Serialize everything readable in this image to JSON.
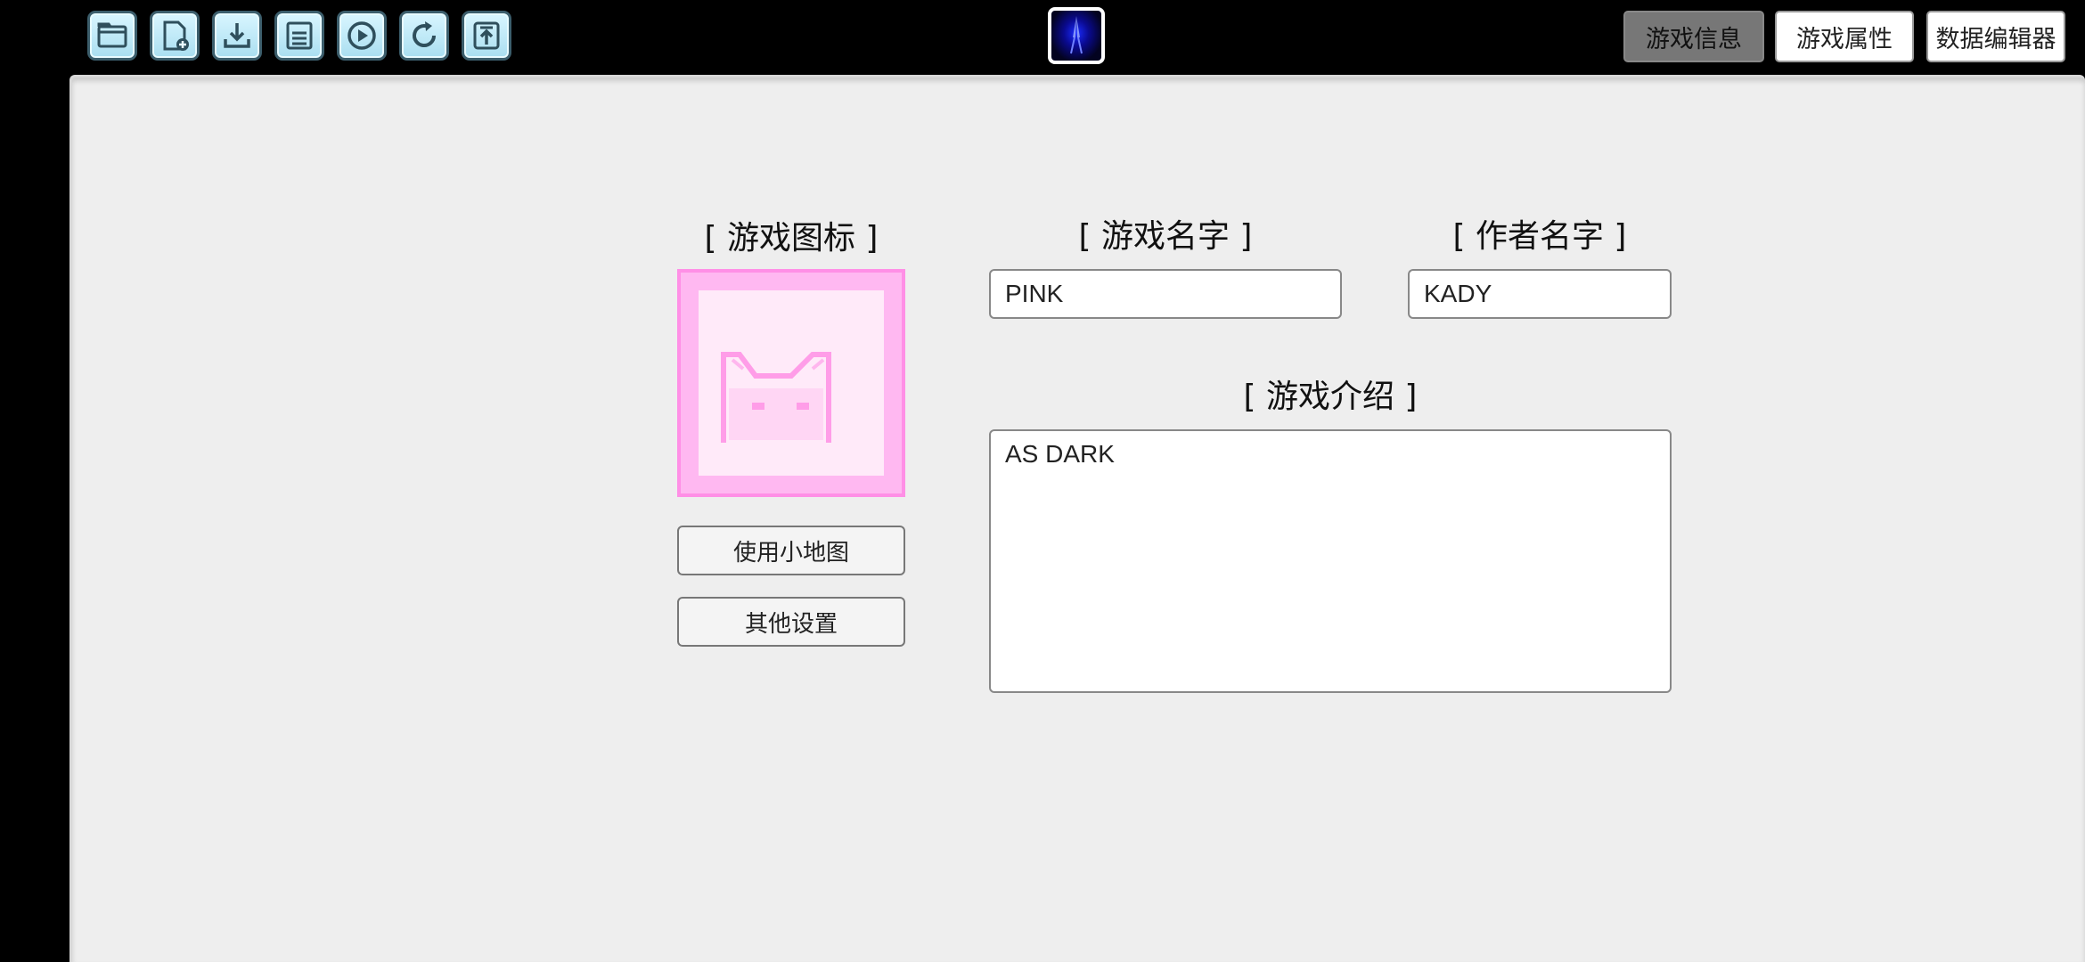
{
  "toolbar": {
    "tools": [
      {
        "name": "open-folder-icon"
      },
      {
        "name": "new-file-icon"
      },
      {
        "name": "download-icon"
      },
      {
        "name": "save-icon"
      },
      {
        "name": "play-icon"
      },
      {
        "name": "refresh-icon"
      },
      {
        "name": "upload-icon"
      }
    ],
    "tabs": {
      "game_info": "游戏信息",
      "game_props": "游戏属性",
      "data_editor": "数据编辑器"
    }
  },
  "form": {
    "icon_label": "[ 游戏图标 ]",
    "name_label": "[ 游戏名字 ]",
    "author_label": "[ 作者名字 ]",
    "intro_label": "[ 游戏介绍 ]",
    "name_value": "PINK",
    "author_value": "KADY",
    "intro_value": "AS DARK",
    "use_minimap_button": "使用小地图",
    "other_settings_button": "其他设置"
  },
  "colors": {
    "accent": "#a9def0",
    "icon_pink": "#ff8fe6",
    "active_tab": "#777777"
  }
}
